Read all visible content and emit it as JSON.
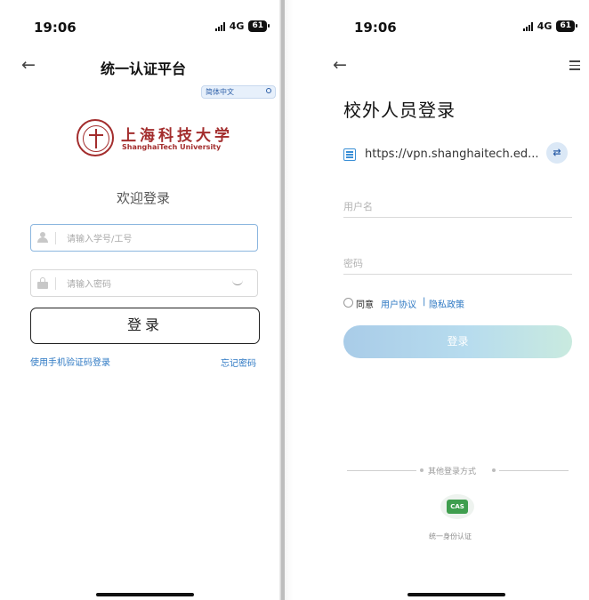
{
  "left_screen": {
    "status": {
      "time": "19:06",
      "network": "4G",
      "battery": "61"
    },
    "nav_title": "统一认证平台",
    "language": "简体中文",
    "logo": {
      "name_cn": "上海科技大学",
      "name_en": "ShanghaiTech University"
    },
    "welcome": "欢迎登录",
    "username_placeholder": "请输入学号/工号",
    "password_placeholder": "请输入密码",
    "login_button": "登录",
    "sms_login_link": "使用手机验证码登录",
    "forgot_password_link": "忘记密码"
  },
  "right_screen": {
    "status": {
      "time": "19:06",
      "network": "4G",
      "battery": "61"
    },
    "page_title": "校外人员登录",
    "server_url": "https://vpn.shanghaitech.ed...",
    "switch_icon_label": "🔄",
    "username_placeholder": "用户名",
    "password_placeholder": "密码",
    "agree_label": "同意",
    "user_agreement_link": "用户协议",
    "link_separator": "|",
    "privacy_policy_link": "隐私政策",
    "login_button": "登录",
    "other_login_label": "其他登录方式",
    "cas_badge": "CAS",
    "cas_label": "统一身份认证"
  },
  "colors": {
    "brand_red": "#a32d2d",
    "link_blue": "#2d78c3",
    "cas_green": "#3f9e4e",
    "login_gradient_start": "#a9cce8",
    "login_gradient_end": "#c9eadf"
  }
}
